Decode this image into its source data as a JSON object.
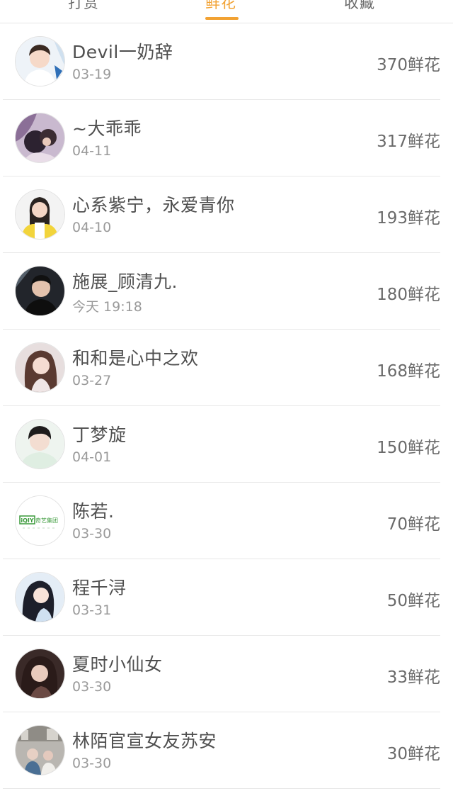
{
  "tabs": [
    {
      "label": "打赏",
      "active": false
    },
    {
      "label": "鲜花",
      "active": true
    },
    {
      "label": "收藏",
      "active": false
    }
  ],
  "colors": {
    "accent": "#f2a233",
    "text_primary": "#4f4f4f",
    "text_secondary": "#9a9a9a",
    "divider": "#e8e8e8"
  },
  "list": [
    {
      "name": "Devil一奶辞",
      "date": "03-19",
      "flowers": "370鲜花",
      "avatar_icon": "user-avatar-icon"
    },
    {
      "name": "~大乖乖",
      "date": "04-11",
      "flowers": "317鲜花",
      "avatar_icon": "user-avatar-icon"
    },
    {
      "name": "心系紫宁，永爱青你",
      "date": "04-10",
      "flowers": "193鲜花",
      "avatar_icon": "user-avatar-icon"
    },
    {
      "name": "施展_顾清九.",
      "date": "今天 19:18",
      "flowers": "180鲜花",
      "avatar_icon": "user-avatar-icon"
    },
    {
      "name": "和和是心中之欢",
      "date": "03-27",
      "flowers": "168鲜花",
      "avatar_icon": "user-avatar-icon"
    },
    {
      "name": "丁梦旋",
      "date": "04-01",
      "flowers": "150鲜花",
      "avatar_icon": "user-avatar-icon"
    },
    {
      "name": "陈若.",
      "date": "03-30",
      "flowers": "70鲜花",
      "avatar_icon": "logo-avatar-icon",
      "avatar_text": "iQIY 奇艺集团"
    },
    {
      "name": "程千浔",
      "date": "03-31",
      "flowers": "50鲜花",
      "avatar_icon": "user-avatar-icon"
    },
    {
      "name": "夏时小仙女",
      "date": "03-30",
      "flowers": "33鲜花",
      "avatar_icon": "user-avatar-icon"
    },
    {
      "name": "林陌官宣女友苏安",
      "date": "03-30",
      "flowers": "30鲜花",
      "avatar_icon": "user-avatar-icon"
    }
  ]
}
